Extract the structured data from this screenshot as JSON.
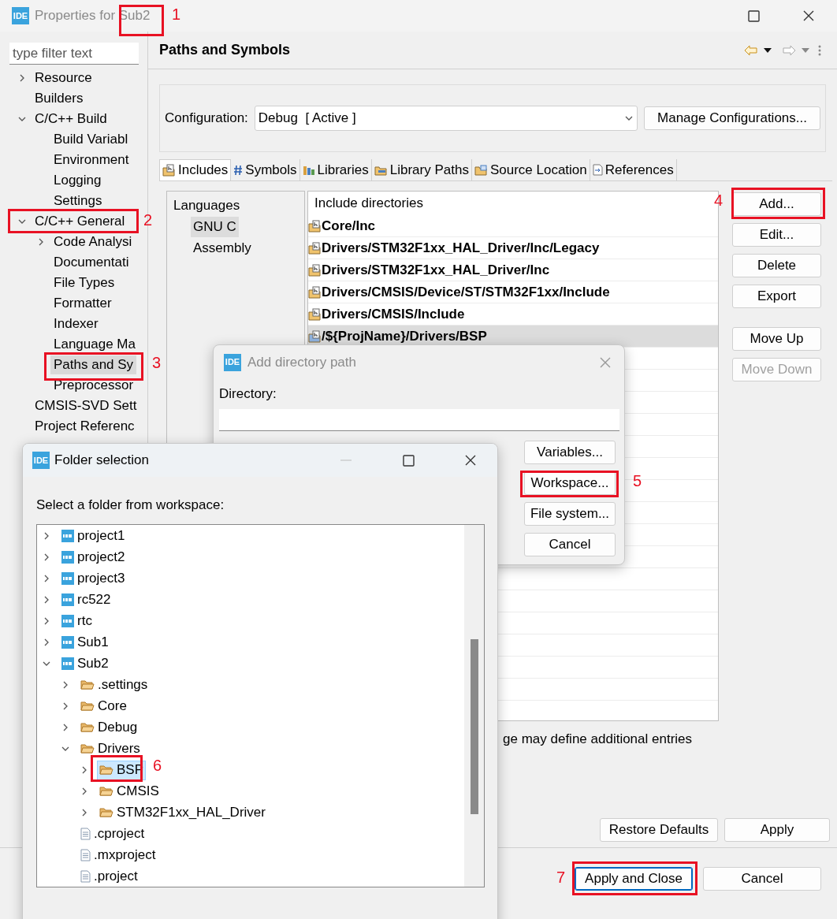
{
  "window": {
    "icon_text": "IDE",
    "title": "Properties for Sub2"
  },
  "sidebar": {
    "filter": {
      "placeholder": "type filter text"
    },
    "tree": [
      {
        "label": "Resource",
        "expanded": false,
        "selected": false
      },
      {
        "label": "Builders",
        "selected": false
      },
      {
        "label": "C/C++ Build",
        "expanded": true,
        "selected": false,
        "children": [
          {
            "label": "Build Variabl",
            "selected": false
          },
          {
            "label": "Environment",
            "selected": false
          },
          {
            "label": "Logging",
            "selected": false
          },
          {
            "label": "Settings",
            "selected": false
          }
        ]
      },
      {
        "label": "C/C++ General",
        "expanded": true,
        "selected": false,
        "children": [
          {
            "label": "Code Analysi",
            "expanded": false,
            "selected": false
          },
          {
            "label": "Documentati",
            "selected": false
          },
          {
            "label": "File Types",
            "selected": false
          },
          {
            "label": "Formatter",
            "selected": false
          },
          {
            "label": "Indexer",
            "selected": false
          },
          {
            "label": "Language Ma",
            "selected": false
          },
          {
            "label": "Paths and Sy",
            "selected": true
          },
          {
            "label": "Preprocessor",
            "selected": false
          }
        ]
      },
      {
        "label": "CMSIS-SVD Sett",
        "selected": false
      },
      {
        "label": "Project Referenc",
        "selected": false
      }
    ]
  },
  "page": {
    "title": "Paths and Symbols"
  },
  "configuration": {
    "label": "Configuration:",
    "value": "Debug  [ Active ]",
    "manage_button": "Manage Configurations..."
  },
  "tabs": [
    {
      "label": "Includes",
      "selected": true
    },
    {
      "label": "Symbols",
      "selected": false
    },
    {
      "label": "Libraries",
      "selected": false
    },
    {
      "label": "Library Paths",
      "selected": false
    },
    {
      "label": "Source Location",
      "selected": false
    },
    {
      "label": "References",
      "selected": false
    }
  ],
  "languages": {
    "header": "Languages",
    "items": [
      {
        "label": "GNU C",
        "selected": true
      },
      {
        "label": "Assembly",
        "selected": false
      }
    ]
  },
  "includes": {
    "header": "Include directories",
    "rows": [
      {
        "path": "Core/Inc",
        "kind": "filesystem",
        "selected": false
      },
      {
        "path": "Drivers/STM32F1xx_HAL_Driver/Inc/Legacy",
        "kind": "filesystem",
        "selected": false
      },
      {
        "path": "Drivers/STM32F1xx_HAL_Driver/Inc",
        "kind": "filesystem",
        "selected": false
      },
      {
        "path": "Drivers/CMSIS/Device/ST/STM32F1xx/Include",
        "kind": "filesystem",
        "selected": false
      },
      {
        "path": "Drivers/CMSIS/Include",
        "kind": "filesystem",
        "selected": false
      },
      {
        "path": "/${ProjName}/Drivers/BSP",
        "kind": "workspace",
        "selected": true
      }
    ]
  },
  "side_buttons": [
    [
      {
        "label": "Add...",
        "disabled": false
      },
      {
        "label": "Edit...",
        "disabled": false
      },
      {
        "label": "Delete",
        "disabled": false
      },
      {
        "label": "Export",
        "disabled": false
      }
    ],
    [
      {
        "label": "Move Up",
        "disabled": false
      },
      {
        "label": "Move Down",
        "disabled": true
      }
    ]
  ],
  "note": "ge may define additional entries",
  "restore_button": "Restore Defaults",
  "apply_button": "Apply",
  "footer_buttons": [
    {
      "label": "Apply and Close",
      "default": true
    },
    {
      "label": "Cancel",
      "default": false
    }
  ],
  "add_dialog": {
    "icon_text": "IDE",
    "title": "Add directory path",
    "directory_label": "Directory:",
    "buttons": [
      "Variables...",
      "Workspace...",
      "File system...",
      "Cancel"
    ]
  },
  "folder_dialog": {
    "icon_text": "IDE",
    "title": "Folder selection",
    "prompt": "Select a folder from workspace:",
    "tree": [
      {
        "label": "project1",
        "kind": "project",
        "expanded": false,
        "selected": false
      },
      {
        "label": "project2",
        "kind": "project",
        "expanded": false,
        "selected": false
      },
      {
        "label": "project3",
        "kind": "project",
        "expanded": false,
        "selected": false
      },
      {
        "label": "rc522",
        "kind": "project",
        "expanded": false,
        "selected": false
      },
      {
        "label": "rtc",
        "kind": "project",
        "expanded": false,
        "selected": false
      },
      {
        "label": "Sub1",
        "kind": "project",
        "expanded": false,
        "selected": false
      },
      {
        "label": "Sub2",
        "kind": "project",
        "expanded": true,
        "selected": false,
        "children": [
          {
            "label": ".settings",
            "kind": "folder",
            "expanded": false,
            "selected": false
          },
          {
            "label": "Core",
            "kind": "folder",
            "expanded": false,
            "selected": false
          },
          {
            "label": "Debug",
            "kind": "folder",
            "expanded": false,
            "selected": false
          },
          {
            "label": "Drivers",
            "kind": "folder",
            "expanded": true,
            "selected": false,
            "children": [
              {
                "label": "BSP",
                "kind": "folder",
                "expanded": false,
                "selected": true
              },
              {
                "label": "CMSIS",
                "kind": "folder",
                "expanded": false,
                "selected": false
              },
              {
                "label": "STM32F1xx_HAL_Driver",
                "kind": "folder",
                "expanded": false,
                "selected": false
              }
            ]
          },
          {
            "label": ".cproject",
            "kind": "file",
            "selected": false
          },
          {
            "label": ".mxproject",
            "kind": "file",
            "selected": false
          },
          {
            "label": ".project",
            "kind": "file",
            "selected": false
          }
        ]
      }
    ]
  },
  "annotations": [
    {
      "label": "1"
    },
    {
      "label": "2"
    },
    {
      "label": "3"
    },
    {
      "label": "4"
    },
    {
      "label": "5"
    },
    {
      "label": "6"
    },
    {
      "label": "7"
    }
  ]
}
